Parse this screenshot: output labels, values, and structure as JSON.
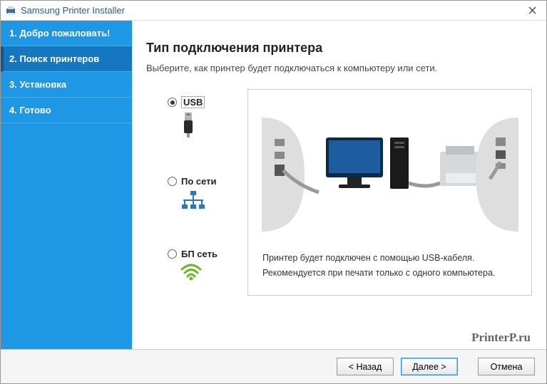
{
  "titlebar": {
    "title": "Samsung Printer Installer"
  },
  "sidebar": {
    "steps": [
      {
        "label": "1. Добро пожаловать!"
      },
      {
        "label": "2. Поиск принтеров"
      },
      {
        "label": "3. Установка"
      },
      {
        "label": "4. Готово"
      }
    ]
  },
  "content": {
    "heading": "Тип подключения принтера",
    "subheading": "Выберите, как принтер будет подключаться к компьютеру или сети.",
    "options": {
      "usb": "USB",
      "network": "По сети",
      "wireless": "БП сеть"
    },
    "preview": {
      "line1": "Принтер будет подключен с помощью USB-кабеля.",
      "line2": "Рекомендуется при печати только с одного компьютера."
    }
  },
  "footer": {
    "back": "< Назад",
    "next": "Далее >",
    "cancel": "Отмена"
  },
  "watermark": "PrinterP.ru"
}
